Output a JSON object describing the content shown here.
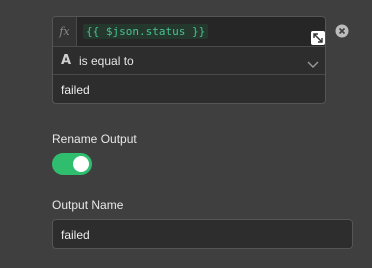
{
  "condition": {
    "fx_label": "fx",
    "expression": "{{ $json.status }}",
    "type_icon_glyph": "A",
    "operator": "is equal to",
    "value": "failed",
    "icons": {
      "expand": "expand-arrows-icon",
      "chevron": "chevron-down-icon",
      "remove": "close-circle-icon"
    }
  },
  "rename_output": {
    "label": "Rename Output",
    "enabled": true,
    "toggle_color": "#2fbe6e"
  },
  "output_name": {
    "label": "Output Name",
    "value": "failed"
  },
  "colors": {
    "background": "#3f3f3f",
    "expression_text": "#4cc08f"
  }
}
